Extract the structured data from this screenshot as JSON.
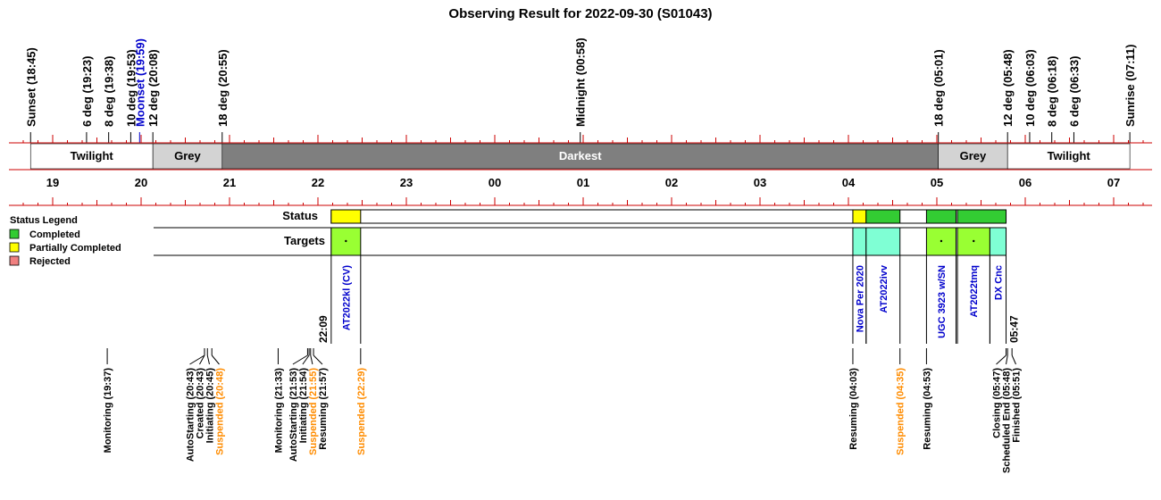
{
  "title": "Observing Result for 2022-09-30 (S01043)",
  "colors": {
    "axis_red": "#cc0000",
    "twilight": "#ffffff",
    "grey": "#d3d3d3",
    "darkest": "#7f7f7f",
    "completed": "#33cc33",
    "partial": "#ffff00",
    "rejected": "#f08080",
    "target_green": "#99ff33",
    "target_cyan": "#7fffd4",
    "target_text": "#0000cc",
    "moon": "#0000cc",
    "suspended": "#ff8c00"
  },
  "top_events": [
    {
      "label": "Sunset (18:45)",
      "t": 18.75
    },
    {
      "label": "6 deg (19:23)",
      "t": 19.383
    },
    {
      "label": "8 deg (19:38)",
      "t": 19.633
    },
    {
      "label": "10 deg (19:53)",
      "t": 19.883
    },
    {
      "label": "Moonset (19:59)",
      "t": 19.983,
      "moon": true
    },
    {
      "label": "12 deg (20:08)",
      "t": 20.133
    },
    {
      "label": "18 deg (20:55)",
      "t": 20.917
    },
    {
      "label": "Midnight (00:58)",
      "t": 24.967
    },
    {
      "label": "18 deg (05:01)",
      "t": 29.017
    },
    {
      "label": "12 deg (05:48)",
      "t": 29.8
    },
    {
      "label": "10 deg (06:03)",
      "t": 30.05
    },
    {
      "label": "8 deg (06:18)",
      "t": 30.3
    },
    {
      "label": "6 deg (06:33)",
      "t": 30.55
    },
    {
      "label": "Sunrise (07:11)",
      "t": 31.183
    }
  ],
  "bands": [
    {
      "label": "Twilight",
      "t0": 18.75,
      "t1": 20.133,
      "kind": "twilight"
    },
    {
      "label": "Grey",
      "t0": 20.133,
      "t1": 20.917,
      "kind": "grey"
    },
    {
      "label": "Darkest",
      "t0": 20.917,
      "t1": 29.017,
      "kind": "darkest"
    },
    {
      "label": "Grey",
      "t0": 29.017,
      "t1": 29.8,
      "kind": "grey"
    },
    {
      "label": "Twilight",
      "t0": 29.8,
      "t1": 31.183,
      "kind": "twilight"
    }
  ],
  "hours": [
    {
      "label": "19",
      "t": 19
    },
    {
      "label": "20",
      "t": 20
    },
    {
      "label": "21",
      "t": 21
    },
    {
      "label": "22",
      "t": 22
    },
    {
      "label": "23",
      "t": 23
    },
    {
      "label": "00",
      "t": 24
    },
    {
      "label": "01",
      "t": 25
    },
    {
      "label": "02",
      "t": 26
    },
    {
      "label": "03",
      "t": 27
    },
    {
      "label": "04",
      "t": 28
    },
    {
      "label": "05",
      "t": 29
    },
    {
      "label": "06",
      "t": 30
    },
    {
      "label": "07",
      "t": 31
    }
  ],
  "legend": {
    "title": "Status Legend",
    "items": [
      {
        "label": "Completed",
        "color": "#33cc33"
      },
      {
        "label": "Partially Completed",
        "color": "#ffff00"
      },
      {
        "label": "Rejected",
        "color": "#f08080"
      }
    ]
  },
  "rows": {
    "status": "Status",
    "targets": "Targets"
  },
  "status_segments": [
    {
      "t0": 22.15,
      "t1": 22.483,
      "status": "partial"
    },
    {
      "t0": 28.05,
      "t1": 28.2,
      "status": "partial"
    },
    {
      "t0": 28.2,
      "t1": 28.583,
      "status": "completed"
    },
    {
      "t0": 28.883,
      "t1": 29.217,
      "status": "completed"
    },
    {
      "t0": 29.233,
      "t1": 29.783,
      "status": "completed"
    }
  ],
  "targets": [
    {
      "name": "AT2022kl (CV)",
      "t0": 22.15,
      "t1": 22.483,
      "color": "target_green",
      "marker": true
    },
    {
      "name": "Nova Per 2020",
      "t0": 28.05,
      "t1": 28.2,
      "color": "target_cyan"
    },
    {
      "name": "AT2022ivv",
      "t0": 28.2,
      "t1": 28.583,
      "color": "target_cyan"
    },
    {
      "name": "UGC 3923 w/SN",
      "t0": 28.883,
      "t1": 29.217,
      "color": "target_green",
      "marker": true
    },
    {
      "name": "AT2022tmq",
      "t0": 29.233,
      "t1": 29.6,
      "color": "target_green",
      "marker": true
    },
    {
      "name": "DX Cnc",
      "t0": 29.6,
      "t1": 29.783,
      "color": "target_cyan"
    }
  ],
  "time_marks": [
    {
      "label": "22:09",
      "t": 22.15
    },
    {
      "label": "05:47",
      "t": 29.783
    }
  ],
  "bottom_events": [
    {
      "label": "Monitoring (19:37)",
      "t": 19.617
    },
    {
      "label": "AutoStarting (20:43)",
      "t": 20.717
    },
    {
      "label": "Created (20:43)",
      "t": 20.717
    },
    {
      "label": "Initiating (20:45)",
      "t": 20.75
    },
    {
      "label": "Suspended (20:48)",
      "t": 20.8,
      "suspended": true
    },
    {
      "label": "Monitoring (21:33)",
      "t": 21.55
    },
    {
      "label": "AutoStarting (21:53)",
      "t": 21.883
    },
    {
      "label": "Initiating (21:54)",
      "t": 21.9
    },
    {
      "label": "Suspended (21:55)",
      "t": 21.917,
      "suspended": true
    },
    {
      "label": "Resuming (21:57)",
      "t": 21.95
    },
    {
      "label": "Suspended (22:29)",
      "t": 22.483,
      "suspended": true
    },
    {
      "label": "Resuming (04:03)",
      "t": 28.05
    },
    {
      "label": "Suspended (04:35)",
      "t": 28.583,
      "suspended": true
    },
    {
      "label": "Resuming (04:53)",
      "t": 28.883
    },
    {
      "label": "Closing (05:47)",
      "t": 29.783
    },
    {
      "label": "Scheduled End (05:48)",
      "t": 29.8
    },
    {
      "label": "Finished (05:51)",
      "t": 29.85
    }
  ]
}
